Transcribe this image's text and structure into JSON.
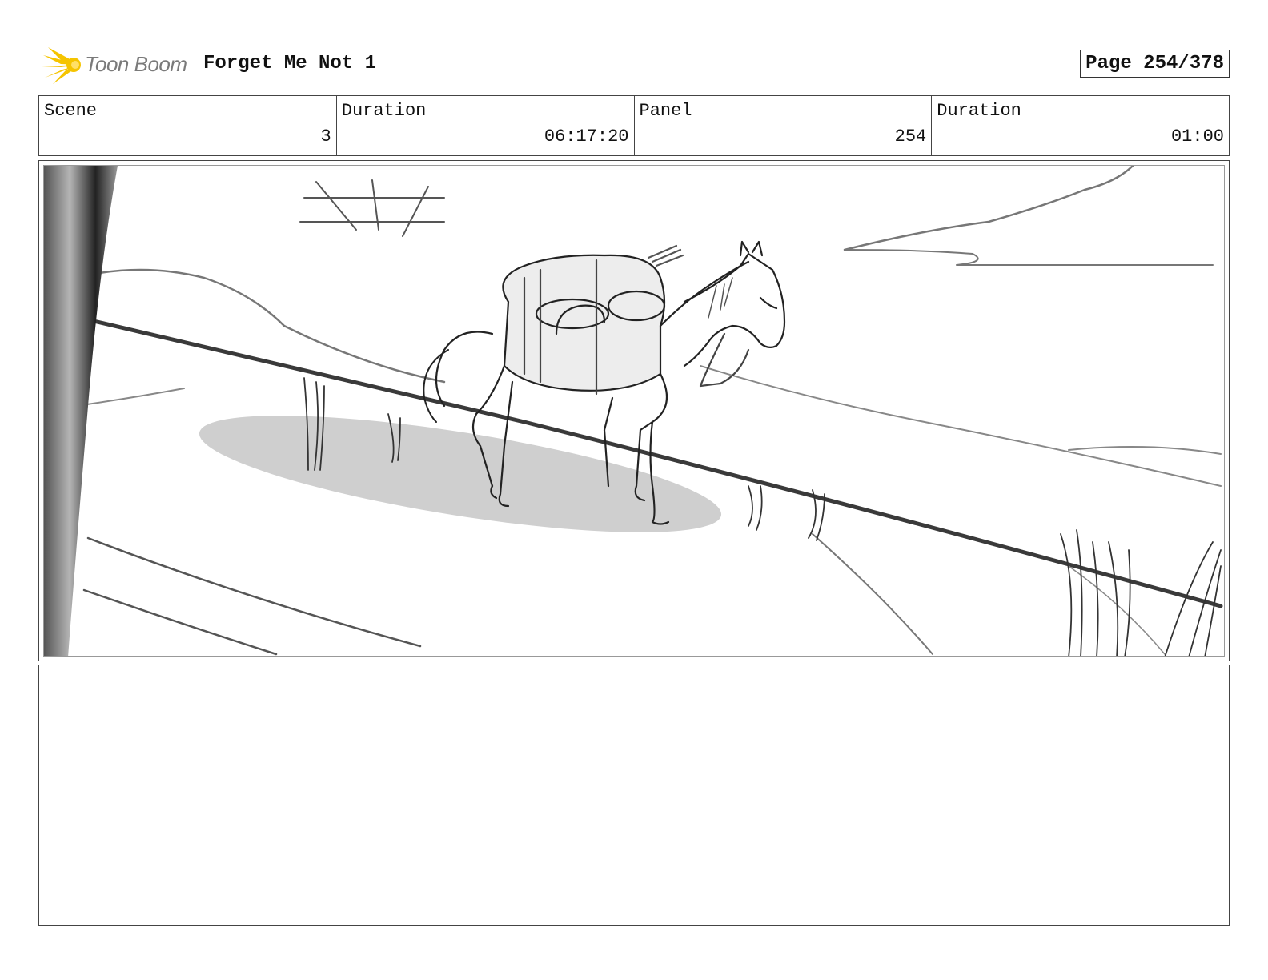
{
  "header": {
    "logo_text": "Toon Boom",
    "project_title": "Forget Me Not 1",
    "page_label": "Page 254/378"
  },
  "info": {
    "scene_label": "Scene",
    "scene_value": "3",
    "scene_duration_label": "Duration",
    "scene_duration_value": "06:17:20",
    "panel_label": "Panel",
    "panel_value": "254",
    "panel_duration_label": "Duration",
    "panel_duration_value": "01:00"
  },
  "colors": {
    "logo_yellow": "#f5c400",
    "logo_text": "#7a7a7a",
    "border": "#444444",
    "sketch_shadow": "#c8c8c8"
  },
  "icons": [
    "toon-boom-logo-icon"
  ]
}
